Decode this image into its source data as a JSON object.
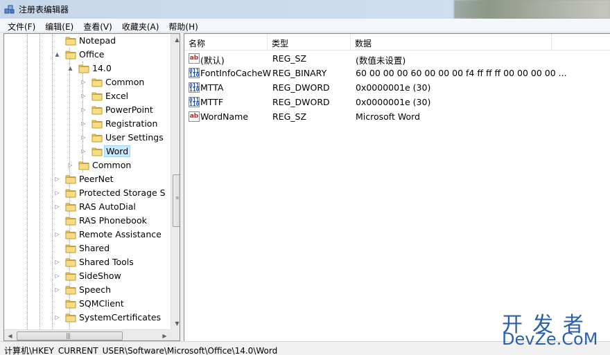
{
  "window": {
    "title": "注册表编辑器"
  },
  "menu": [
    "文件(F)",
    "编辑(E)",
    "查看(V)",
    "收藏夹(A)",
    "帮助(H)"
  ],
  "tree": {
    "items": [
      {
        "label": "Notepad",
        "expander": ""
      },
      {
        "label": "Office",
        "expander": "▲"
      },
      {
        "label": "14.0",
        "expander": "▲"
      },
      {
        "label": "Common",
        "expander": "▷"
      },
      {
        "label": "Excel",
        "expander": "▷"
      },
      {
        "label": "PowerPoint",
        "expander": "▷"
      },
      {
        "label": "Registration",
        "expander": "▷"
      },
      {
        "label": "User Settings",
        "expander": "▷"
      },
      {
        "label": "Word",
        "expander": "▷",
        "selected": true
      },
      {
        "label": "Common",
        "expander": "▷"
      },
      {
        "label": "PeerNet",
        "expander": "▷"
      },
      {
        "label": "Protected Storage S",
        "expander": "▷"
      },
      {
        "label": "RAS AutoDial",
        "expander": "▷"
      },
      {
        "label": "RAS Phonebook",
        "expander": ""
      },
      {
        "label": "Remote Assistance",
        "expander": "▷"
      },
      {
        "label": "Shared",
        "expander": ""
      },
      {
        "label": "Shared Tools",
        "expander": "▷"
      },
      {
        "label": "SideShow",
        "expander": "▷"
      },
      {
        "label": "Speech",
        "expander": "▷"
      },
      {
        "label": "SQMClient",
        "expander": ""
      },
      {
        "label": "SystemCertificates",
        "expander": "▷"
      }
    ]
  },
  "values": {
    "columns": [
      "名称",
      "类型",
      "数据"
    ],
    "rows": [
      {
        "icon": "string-value-icon",
        "name": "(默认)",
        "type": "REG_SZ",
        "data": "(数值未设置)"
      },
      {
        "icon": "binary-value-icon",
        "name": "FontInfoCacheW",
        "type": "REG_BINARY",
        "data": "60 00 00 00 60 00 00 00 f4 ff ff ff 00 00 00 00 ..."
      },
      {
        "icon": "binary-value-icon",
        "name": "MTTA",
        "type": "REG_DWORD",
        "data": "0x0000001e (30)"
      },
      {
        "icon": "binary-value-icon",
        "name": "MTTF",
        "type": "REG_DWORD",
        "data": "0x0000001e (30)"
      },
      {
        "icon": "string-value-icon",
        "name": "WordName",
        "type": "REG_SZ",
        "data": "Microsoft Word"
      }
    ]
  },
  "status": {
    "path": "计算机\\HKEY_CURRENT_USER\\Software\\Microsoft\\Office\\14.0\\Word"
  },
  "watermark": {
    "cn": "开发者",
    "en": "DevZe.CoM"
  },
  "icon_labels": {
    "sz": "ab",
    "bin": "011 110"
  }
}
